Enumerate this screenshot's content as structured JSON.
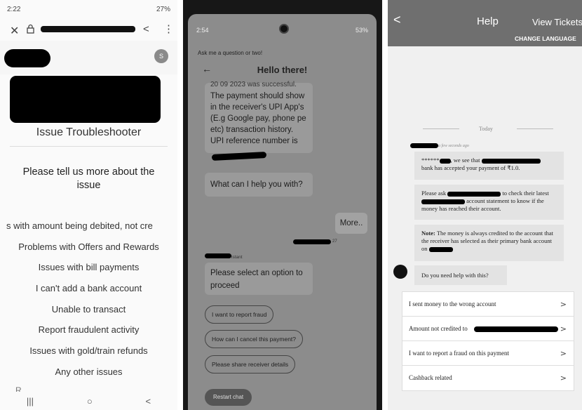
{
  "panel1": {
    "status_time": "2:22",
    "status_right": "27%",
    "close_glyph": "✕",
    "share_glyph": "<",
    "menu_glyph": "⋮",
    "avatar_letter": "S",
    "title": "Issue Troubleshooter",
    "prompt": "Please tell us more about the issue",
    "issues": [
      "s with amount being debited, not cre",
      "Problems with Offers and Rewards",
      "Issues with bill payments",
      "I can't add a bank account",
      "Unable to transact",
      "Report fraudulent activity",
      "Issues with gold/train refunds",
      "Any other issues"
    ],
    "partial_item": "R...",
    "nav": {
      "recents": "|||",
      "home": "○",
      "back": "<"
    }
  },
  "panel2": {
    "status_time": "2:54",
    "status_right": "53%",
    "hint": "Ask me a question or two!",
    "header": "Hello there!",
    "msg1_cut": "20 09 2023 was successful.",
    "msg1": "The payment should show in the receiver's UPI App's (E.g Google pay, phone pe etc) transaction history. UPI reference number is",
    "msg2": "What can I help you with?",
    "user_reply": "More..",
    "assistant_label": "istant",
    "msg3": "Please select an option to proceed",
    "options": [
      "I want to report fraud",
      "How can I cancel this payment?",
      "Please share receiver details"
    ],
    "restart": "Restart chat"
  },
  "panel3": {
    "back_glyph": "<",
    "title": "Help",
    "view_tickets": "View Tickets",
    "change_language": "CHANGE LANGUAGE",
    "today": "Today",
    "ago": "a few seconds ago",
    "msg1_a": "******",
    "msg1_b": ", we see that",
    "msg1_c": "bank has accepted your payment of ₹1.0.",
    "msg2_a": "Please ask",
    "msg2_b": "to check their latest",
    "msg2_c": "account statement to know if the money has reached their account.",
    "msg3_bold": "Note:",
    "msg3": "The money is always credited to the account that the receiver has selected as their primary bank account on",
    "msg4": "Do you need help with this?",
    "options": [
      "I sent money to the wrong account",
      "Amount not credited to",
      "I want to report a fraud on this payment",
      "Cashback related"
    ]
  }
}
